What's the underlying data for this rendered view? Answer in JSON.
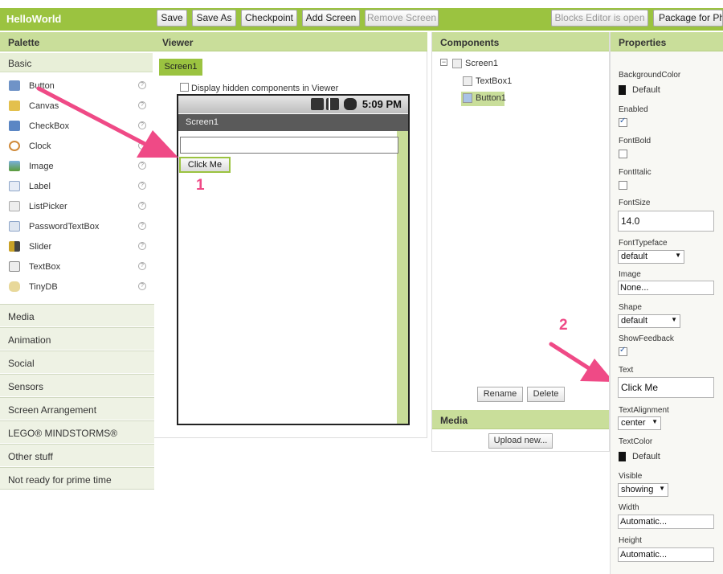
{
  "app": {
    "title": "HelloWorld"
  },
  "toolbar": {
    "save": "Save",
    "save_as": "Save As",
    "checkpoint": "Checkpoint",
    "add_screen": "Add Screen",
    "remove_screen": "Remove Screen",
    "blocks_editor": "Blocks Editor is open",
    "package": "Package for Phone"
  },
  "palette": {
    "title": "Palette",
    "basic": "Basic",
    "items": [
      {
        "label": "Button",
        "icon": "button-icon"
      },
      {
        "label": "Canvas",
        "icon": "canvas-icon"
      },
      {
        "label": "CheckBox",
        "icon": "checkbox-icon"
      },
      {
        "label": "Clock",
        "icon": "clock-icon"
      },
      {
        "label": "Image",
        "icon": "image-icon"
      },
      {
        "label": "Label",
        "icon": "label-icon"
      },
      {
        "label": "ListPicker",
        "icon": "listpicker-icon"
      },
      {
        "label": "PasswordTextBox",
        "icon": "password-icon"
      },
      {
        "label": "Slider",
        "icon": "slider-icon"
      },
      {
        "label": "TextBox",
        "icon": "textbox-icon"
      },
      {
        "label": "TinyDB",
        "icon": "database-icon"
      }
    ],
    "help_glyph": "?",
    "categories": [
      "Media",
      "Animation",
      "Social",
      "Sensors",
      "Screen Arrangement",
      "LEGO® MINDSTORMS®",
      "Other stuff",
      "Not ready for prime time"
    ]
  },
  "viewer": {
    "title": "Viewer",
    "screen_tab": "Screen1",
    "display_hidden": "Display hidden components in Viewer",
    "phone": {
      "time": "5:09 PM",
      "title": "Screen1",
      "button_text": "Click Me"
    }
  },
  "annotations": {
    "one": "1",
    "two": "2"
  },
  "components": {
    "title": "Components",
    "tree": [
      "Screen1",
      "TextBox1",
      "Button1"
    ],
    "rename": "Rename",
    "delete": "Delete"
  },
  "media": {
    "title": "Media",
    "upload": "Upload new..."
  },
  "properties": {
    "title": "Properties",
    "background_color": {
      "label": "BackgroundColor",
      "value": "Default"
    },
    "enabled": {
      "label": "Enabled"
    },
    "font_bold": {
      "label": "FontBold"
    },
    "font_italic": {
      "label": "FontItalic"
    },
    "font_size": {
      "label": "FontSize",
      "value": "14.0"
    },
    "font_typeface": {
      "label": "FontTypeface",
      "value": "default"
    },
    "image": {
      "label": "Image",
      "value": "None..."
    },
    "shape": {
      "label": "Shape",
      "value": "default"
    },
    "show_feedback": {
      "label": "ShowFeedback"
    },
    "text": {
      "label": "Text",
      "value": "Click Me"
    },
    "text_alignment": {
      "label": "TextAlignment",
      "value": "center"
    },
    "text_color": {
      "label": "TextColor",
      "value": "Default"
    },
    "visible": {
      "label": "Visible",
      "value": "showing"
    },
    "width": {
      "label": "Width",
      "value": "Automatic..."
    },
    "height": {
      "label": "Height",
      "value": "Automatic..."
    }
  },
  "colors": {
    "accent": "#9bc340",
    "header": "#c9de9a",
    "annotation": "#ef4a86"
  }
}
